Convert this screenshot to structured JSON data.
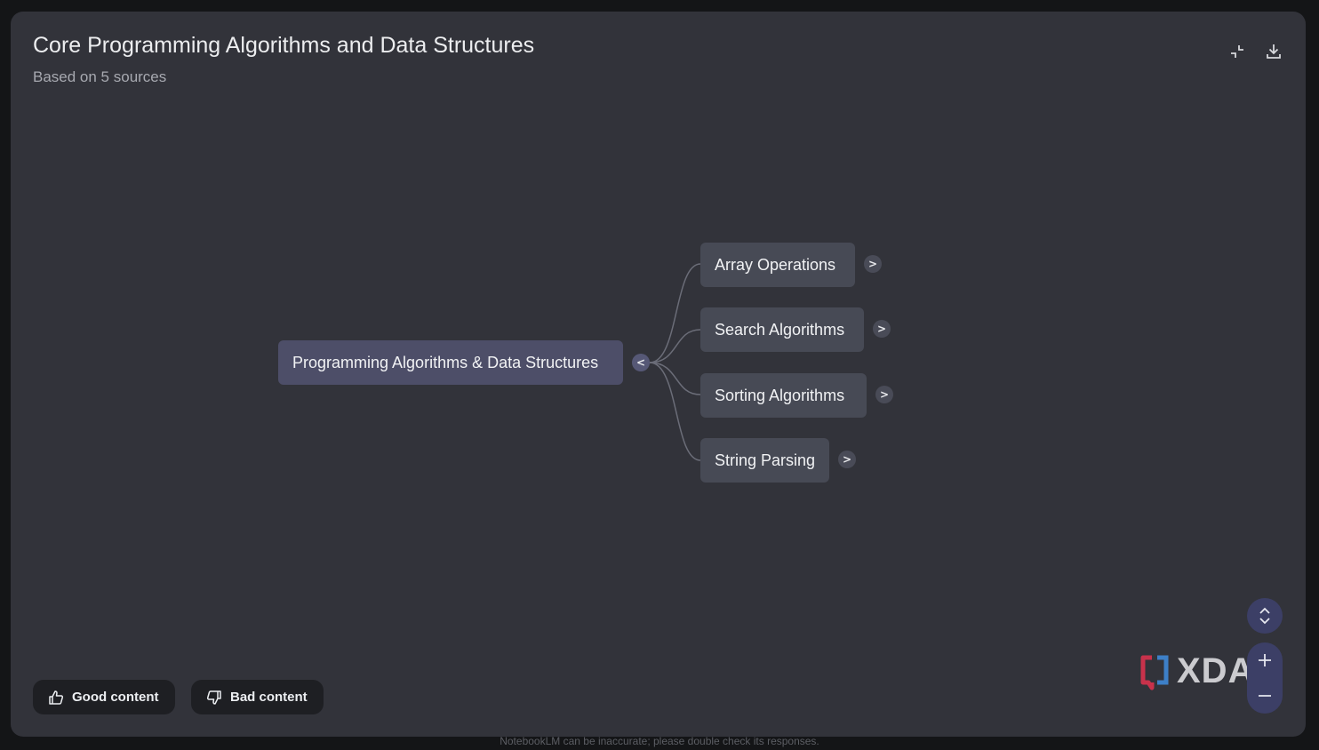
{
  "header": {
    "title": "Core Programming Algorithms and Data Structures",
    "subtitle": "Based on 5 sources",
    "collapse_icon": "collapse-icon",
    "download_icon": "download-icon"
  },
  "mindmap": {
    "root": {
      "label": "Programming Algorithms & Data Structures",
      "toggle": "<"
    },
    "children": [
      {
        "label": "Array Operations",
        "toggle": ">"
      },
      {
        "label": "Search Algorithms",
        "toggle": ">"
      },
      {
        "label": "Sorting Algorithms",
        "toggle": ">"
      },
      {
        "label": "String Parsing",
        "toggle": ">"
      }
    ]
  },
  "feedback": {
    "good_label": "Good content",
    "bad_label": "Bad content",
    "good_icon": "thumbs-up-icon",
    "bad_icon": "thumbs-down-icon"
  },
  "controls": {
    "nav_icon": "unfold-icon",
    "zoom_in_icon": "plus-icon",
    "zoom_out_icon": "minus-icon"
  },
  "watermark": {
    "text": "XDA"
  },
  "footer": {
    "disclaimer": "NotebookLM can be inaccurate; please double check its responses."
  },
  "colors": {
    "background": "#141517",
    "panel": "#32333a",
    "root_node": "#4d4e68",
    "child_node": "#474a55",
    "connector": "#6b6d78",
    "zoom_controls": "#3c3f66"
  }
}
